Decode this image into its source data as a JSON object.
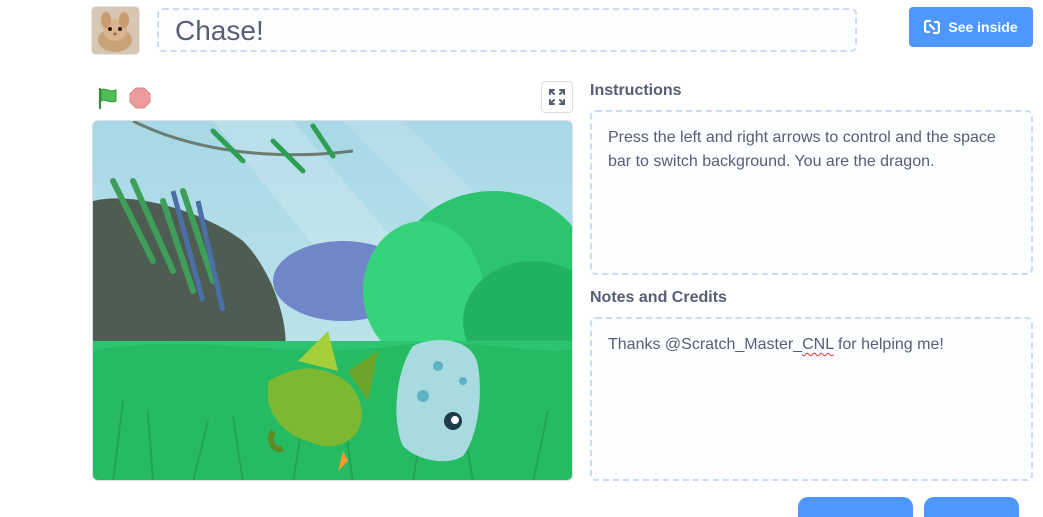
{
  "project": {
    "title": "Chase!"
  },
  "header": {
    "see_inside_label": "See inside"
  },
  "instructions": {
    "heading": "Instructions",
    "text": "Press the left and right arrows to control and the space bar to switch background. You are the dragon."
  },
  "notes": {
    "heading": "Notes and Credits",
    "text_before": "Thanks @Scratch_Master_",
    "text_misspelled": "CNL",
    "text_after": " for helping me!"
  },
  "colors": {
    "accent": "#4d97ff",
    "flag": "#4cbf56",
    "stop": "#ec9c9c",
    "text": "#575e75"
  },
  "icons": {
    "flag": "green-flag-icon",
    "stop": "stop-sign-icon",
    "fullscreen": "fullscreen-icon",
    "see_inside": "remix-arrows-icon"
  }
}
